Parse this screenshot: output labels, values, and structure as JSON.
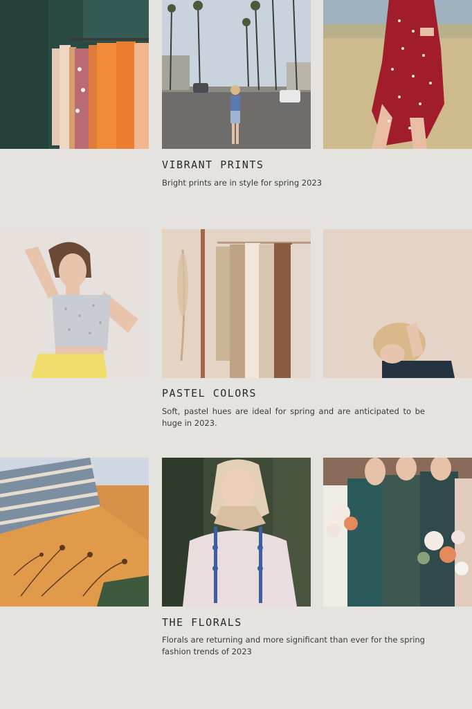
{
  "sections": [
    {
      "title": "VIBRANT PRINTS",
      "description": "Bright prints are in style for spring 2023",
      "images": [
        "clothing-rack-photo",
        "street-palm-trees-photo",
        "polka-dot-dress-photo"
      ]
    },
    {
      "title": "PASTEL COLORS",
      "description": "Soft, pastel hues are ideal for spring and are anticipated to be huge in 2023.",
      "images": [
        "woman-yellow-skirt-photo",
        "knitwear-rack-photo",
        "blonde-woman-photo"
      ]
    },
    {
      "title": "THE FLORALS",
      "description": "Florals are returning and more significant than ever for the spring fashion trends of 2023",
      "images": [
        "floral-fabric-photo",
        "woman-headscarf-photo",
        "bridesmaids-bouquets-photo"
      ]
    }
  ],
  "colors": {
    "background": "#e5e3df",
    "text": "#2f2f2f"
  }
}
